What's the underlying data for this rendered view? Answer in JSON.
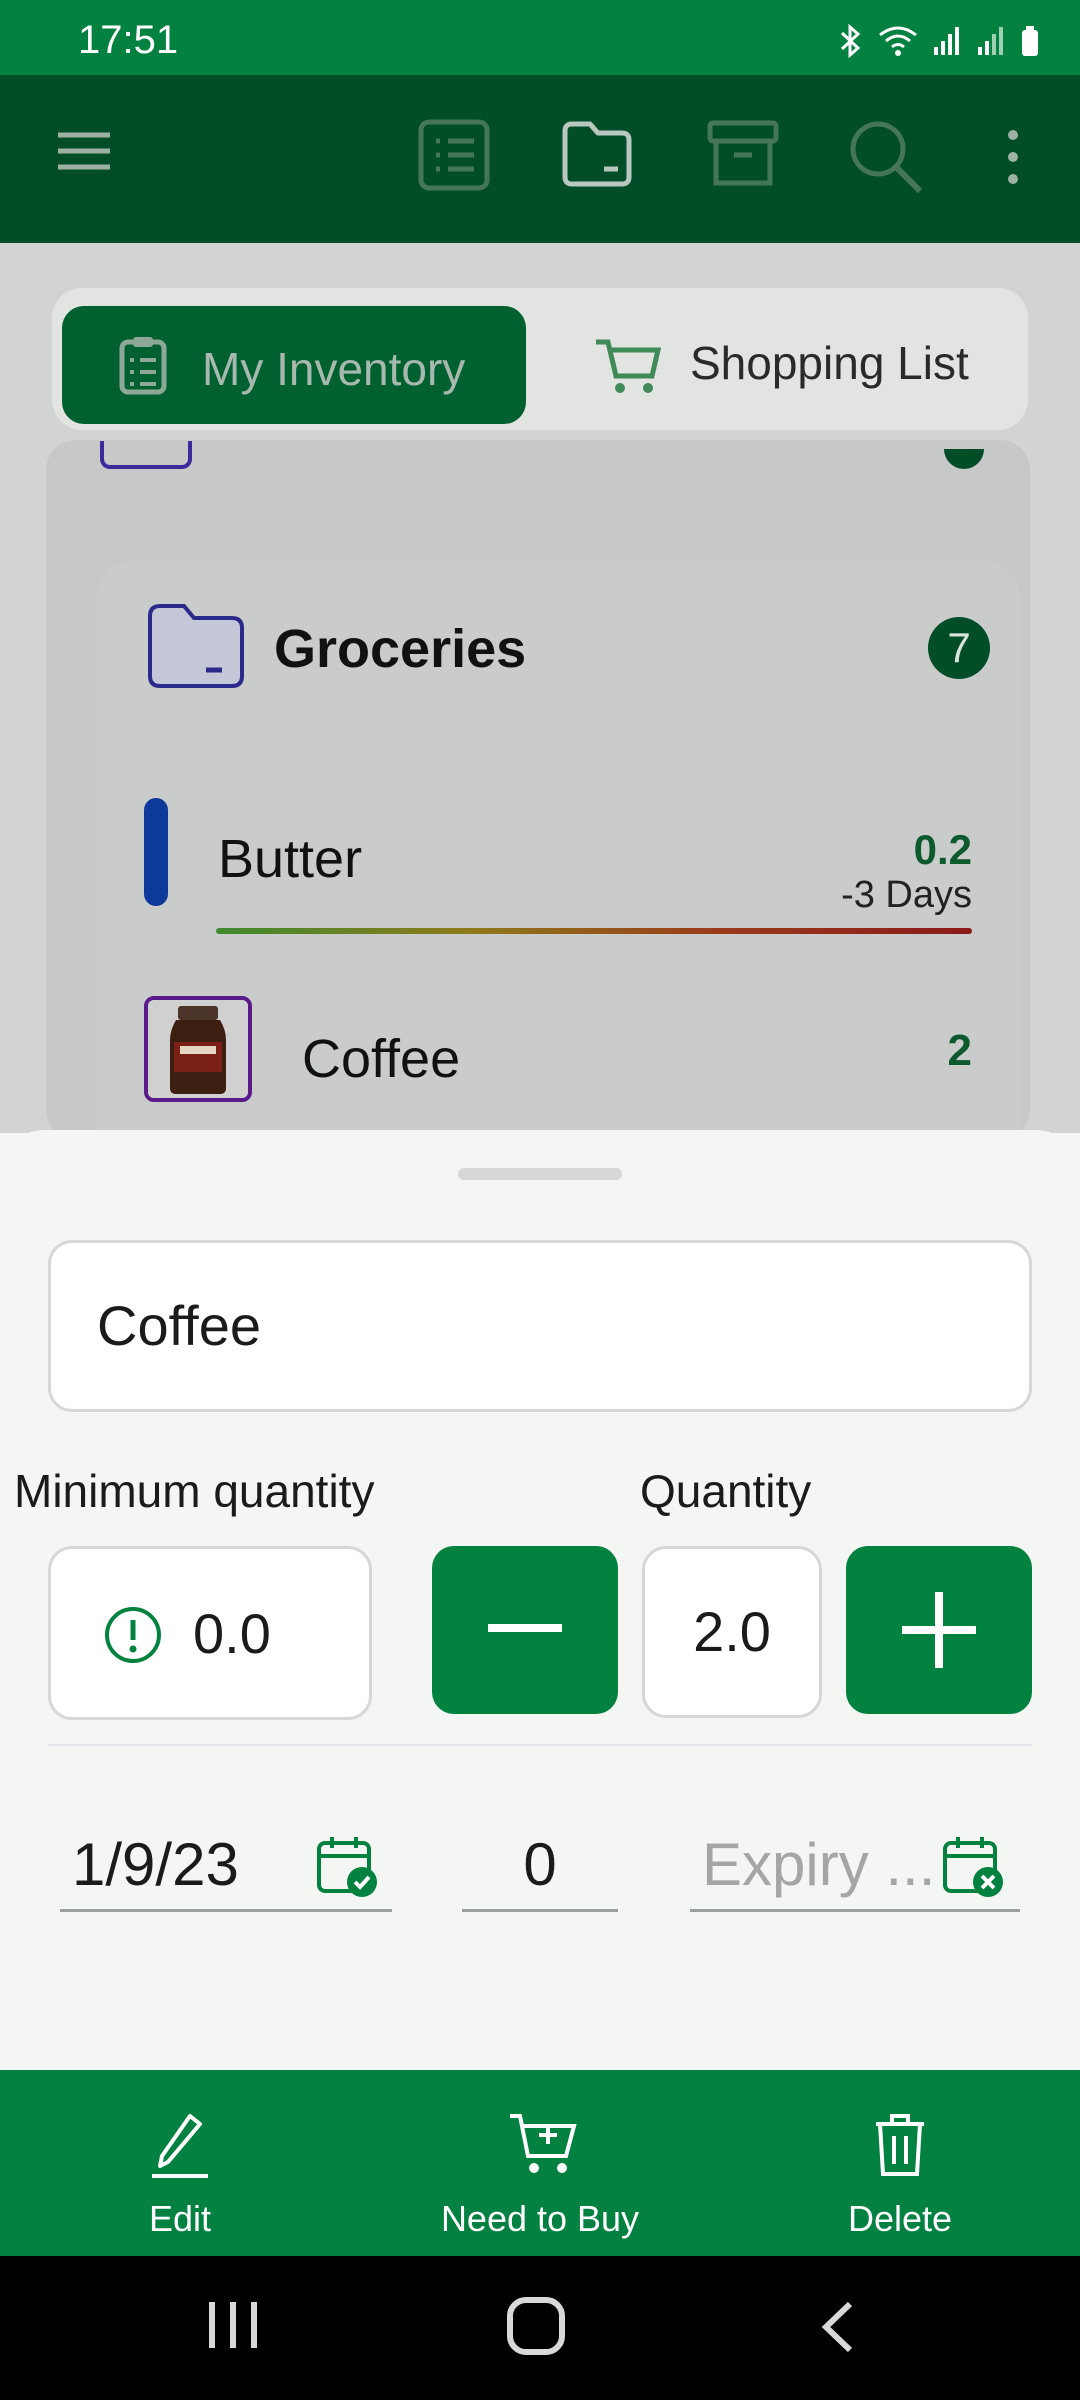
{
  "status_bar": {
    "time": "17:51"
  },
  "tabs": {
    "inventory": "My Inventory",
    "shopping": "Shopping List"
  },
  "group": {
    "title": "Groceries",
    "count": "7"
  },
  "items": [
    {
      "name": "Butter",
      "qty": "0.2",
      "expiry": "-3 Days",
      "color": "#0b3a9a"
    },
    {
      "name": "Coffee",
      "qty": "2"
    }
  ],
  "sheet": {
    "name": "Coffee",
    "min_label": "Minimum quantity",
    "min_value": "0.0",
    "qty_label": "Quantity",
    "qty_value": "2.0",
    "date": "1/9/23",
    "days": "0",
    "expiry_placeholder": "Expiry ..."
  },
  "actions": {
    "edit": "Edit",
    "need": "Need to Buy",
    "delete": "Delete"
  },
  "colors": {
    "primary": "#028140",
    "dark": "#014d27"
  }
}
